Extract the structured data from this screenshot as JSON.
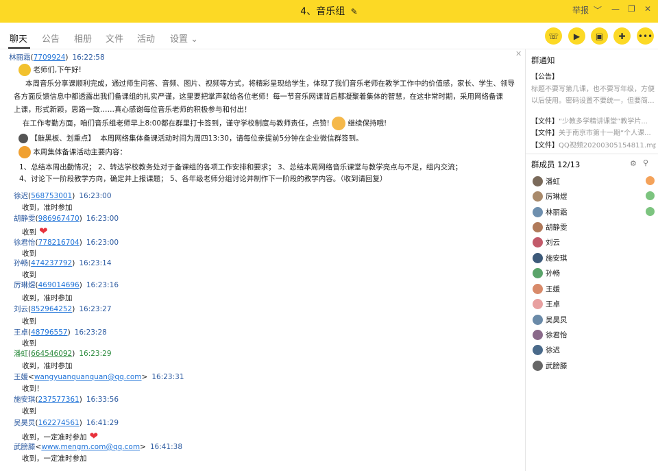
{
  "window": {
    "title": "4、音乐组",
    "report_label": "举报",
    "controls": [
      "﹀",
      "—",
      "❐",
      "✕"
    ]
  },
  "tabs": [
    "聊天",
    "公告",
    "相册",
    "文件",
    "活动",
    "设置"
  ],
  "settings_caret": "⌄",
  "chat": {
    "first": {
      "name": "林丽霜",
      "id": "7709924",
      "time": "16:22:58"
    },
    "announcement": {
      "greeting": "老师们,下午好!",
      "p1_l1": "本周音乐分享课顺利完成，通过师生问答、音频、图片、视频等方式，将精彩呈现给学生，体现了我们音乐老师在教学工作中的价值感，家长、学生、领导",
      "p1_l2": "各方面反馈信息中都透露出我们备课组的扎实严谨，这里要把掌声献给各位老师！每一节音乐网课背后都凝聚着集体的智慧，在这非常时期，采用网络备课",
      "p1_l3": "上课，形式新颖，思路一致……真心感谢每位音乐老师的积极参与和付出！",
      "p2": "在工作考勤方面，咱们音乐组老师早上8:00都在群里打卡签到，谨守学校制度与教师责任，点赞!",
      "p2_tail": "继续保持哦!",
      "p3_tag": "【敲黑板、划重点】",
      "p3": "本周网络集体备课活动时间为周四13:30，请每位亲提前5分钟在企业微信群签到。",
      "p4": "本周集体备课活动主要内容：",
      "p5": "1、总结本周出勤情况； 2、转达学校教务处对于备课组的各项工作安排和要求； 3、总结本周网络音乐课堂与教学亮点与不足，组内交流；",
      "p6": "4、讨论下一阶段教学方向，确定并上报课题； 5、各年级老师分组讨论并制作下一阶段的教学内容。（收到请回复）"
    },
    "messages": [
      {
        "name": "徐迟",
        "id": "568753001",
        "time": "16:23:00",
        "text": "收到，准时参加"
      },
      {
        "name": "胡静雯",
        "id": "986967470",
        "time": "16:23:00",
        "text": "收到"
      },
      {
        "name": "徐君怡",
        "id": "778216704",
        "time": "16:23:00",
        "text": "收到"
      },
      {
        "name": "孙畅",
        "id": "474237792",
        "time": "16:23:14",
        "text": "收到"
      },
      {
        "name": "厉琳煜",
        "id": "469014696",
        "time": "16:23:16",
        "text": "收到，准时参加"
      },
      {
        "name": "刘云",
        "id": "852964252",
        "time": "16:23:27",
        "text": "收到"
      },
      {
        "name": "王卓",
        "id": "48796557",
        "time": "16:23:28",
        "text": "收到"
      },
      {
        "name": "潘虹",
        "id": "664546092",
        "time": "16:23:29",
        "text": "收到，准时参加"
      },
      {
        "name": "王媛",
        "id": "wangyuanquanquan@qq.com",
        "time": "16:23:31",
        "text": "收到！"
      },
      {
        "name": "施安琪",
        "id": "237577361",
        "time": "16:33:56",
        "text": "收到"
      },
      {
        "name": "吴昊炅",
        "id": "162274561",
        "time": "16:41:29",
        "text": "收到，一定准时参加"
      },
      {
        "name": "武膀滕",
        "id": "www.mengm.com@qq.com",
        "time": "16:41:38",
        "text": "收到，一定准时参加"
      }
    ]
  },
  "notice_panel": {
    "title": "群通知",
    "announcement_tag": "【公告】",
    "notice_l1": "标题不要写第几课，也不要写年级，方便",
    "notice_l2": "以后使用。密码设置不要统一，但要简...",
    "files": [
      {
        "tag": "【文件】",
        "name": "“少教多学精讲课堂”教学片..."
      },
      {
        "tag": "【文件】",
        "name": "关于南京市第十一期“个人课..."
      },
      {
        "tag": "【文件】",
        "name": "QQ视频20200305154811.mp4"
      }
    ]
  },
  "members": {
    "title": "群成员 12/13",
    "list": [
      {
        "name": "潘虹",
        "admin": true
      },
      {
        "name": "厉琳煜",
        "admin": true
      },
      {
        "name": "林丽霜",
        "admin": true
      },
      {
        "name": "胡静雯",
        "admin": false
      },
      {
        "name": "刘云",
        "admin": false
      },
      {
        "name": "施安琪",
        "admin": false
      },
      {
        "name": "孙畅",
        "admin": false
      },
      {
        "name": "王媛",
        "admin": false
      },
      {
        "name": "王卓",
        "admin": false
      },
      {
        "name": "吴昊炅",
        "admin": false
      },
      {
        "name": "徐君怡",
        "admin": false
      },
      {
        "name": "徐迟",
        "admin": false
      },
      {
        "name": "武膀滕",
        "admin": false
      }
    ]
  },
  "colors": {
    "titlebar": "#fcd925",
    "link": "#1f73d8",
    "name": "#2c5aa0"
  }
}
